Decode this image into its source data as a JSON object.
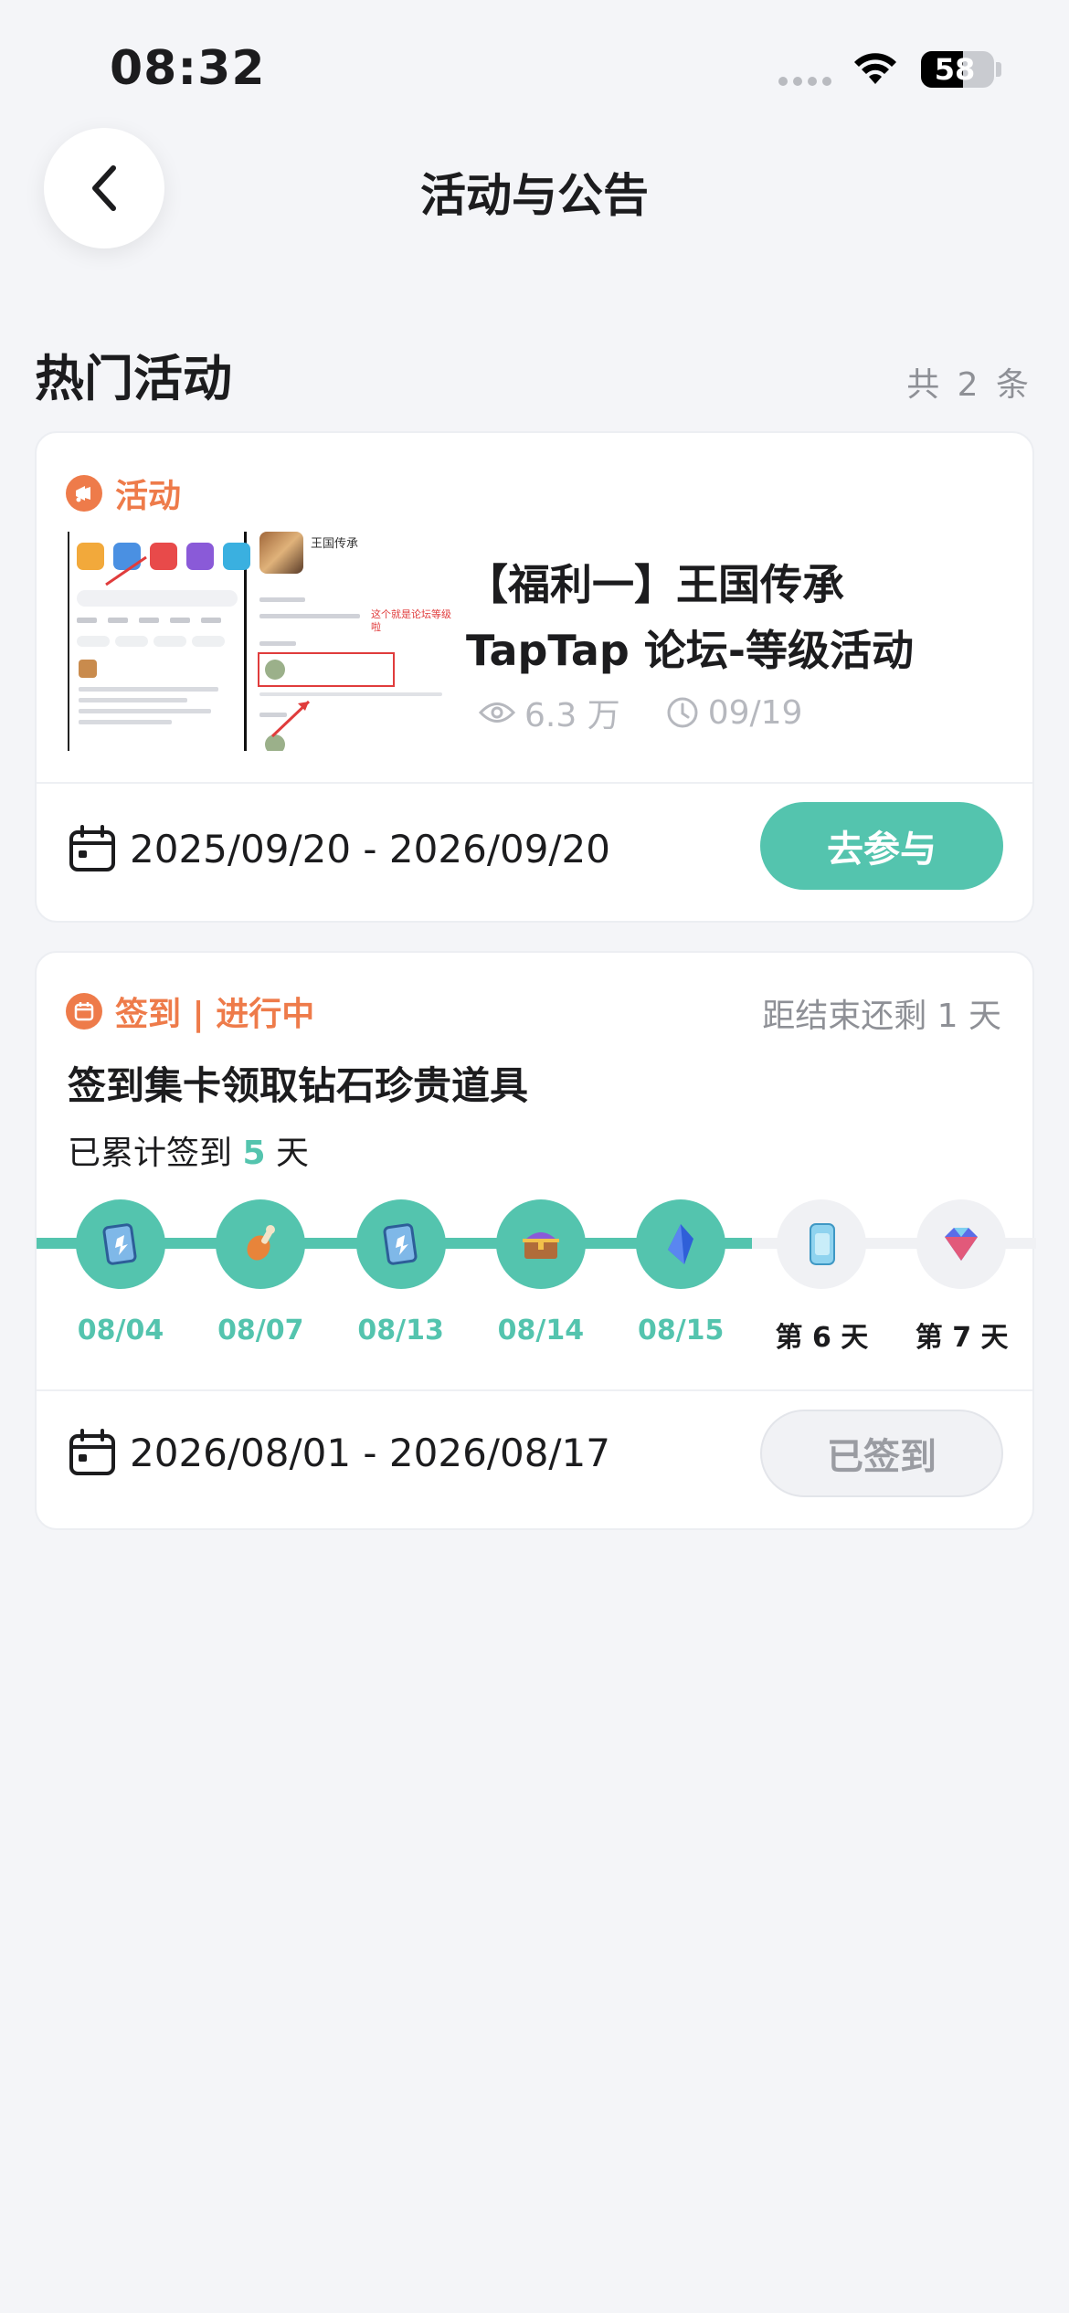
{
  "status_bar": {
    "time": "08:32",
    "battery": "58",
    "battery_level": 0.58
  },
  "nav": {
    "title": "活动与公告"
  },
  "section": {
    "title": "热门活动",
    "count": "共 2 条"
  },
  "activity_card": {
    "tag": "活动",
    "thumbnail": {
      "game_name": "王国传承",
      "note": "这个就是论坛等级啦"
    },
    "title": "【福利一】王国传承 TapTap 论坛-等级活动",
    "views": "6.3 万",
    "date": "09/19",
    "period": "2025/09/20 - 2026/09/20",
    "button_label": "去参与",
    "accent_color": "#54c4ae"
  },
  "signin_card": {
    "tag": "签到 | 进行中",
    "remaining": "距结束还剩 1 天",
    "title": "签到集卡领取钻石珍贵道具",
    "progress_prefix": "已累计签到 ",
    "progress_count": "5",
    "progress_suffix": " 天",
    "days": [
      {
        "label": "08/04",
        "done": true,
        "icon": "card-reward-icon"
      },
      {
        "label": "08/07",
        "done": true,
        "icon": "meat-reward-icon"
      },
      {
        "label": "08/13",
        "done": true,
        "icon": "card-reward-icon"
      },
      {
        "label": "08/14",
        "done": true,
        "icon": "treasure-chest-icon"
      },
      {
        "label": "08/15",
        "done": true,
        "icon": "blue-crystal-icon"
      },
      {
        "label": "第 6 天",
        "done": false,
        "icon": "card-pack-icon"
      },
      {
        "label": "第 7 天",
        "done": false,
        "icon": "diamond-icon"
      }
    ],
    "period": "2026/08/01 - 2026/08/17",
    "button_label": "已签到"
  }
}
